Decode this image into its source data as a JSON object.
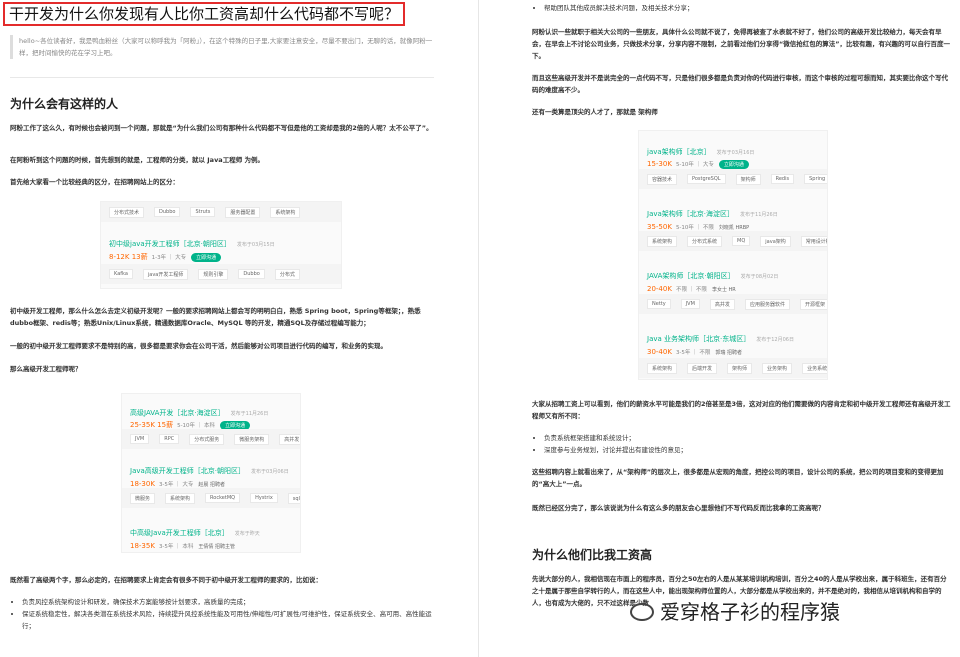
{
  "title": "干开发为什么你发现有人比你工资高却什么代码都不写呢？",
  "quote": "hello~各位读者好，我是鸭血粉丝（大家可以称呼我为「阿粉」），在这个特殊的日子里,大家要注意安全，尽量不要出门，无聊的话，就像阿粉一样，把时间愉快的花在学习上吧。",
  "sec1": {
    "heading": "为什么会有这样的人",
    "p1": "阿粉工作了这么久，有时候也会被问到一个问题，那就是“为什么我们公司有那种什么代码都不写但是他的工资却是我的2倍的人呢？太不公平了”。",
    "p2": "在阿粉听到这个问题的时候，首先想到的就是，工程师的分类，就以 Java工程师 为例。",
    "p3": "首先给大家看一个比较经典的区分，在招聘网站上的区分："
  },
  "card1": {
    "tags_top": [
      "分布式技术",
      "Dubbo",
      "Struts",
      "服务器配置",
      "系统架构"
    ],
    "title": "初中级java开发工程师［北京·朝阳区］",
    "pub": "发布于03月15日",
    "salary": "8-12K 13薪",
    "meta": "1-3年 ｜ 大专",
    "pill": "立即沟通",
    "tags_bottom": [
      "Kafka",
      "java开发工程师",
      "规则引擎",
      "Dubbo",
      "分布式"
    ]
  },
  "p_mid1": "初中级开发工程师，那么什么怎么去定义初级开发呢？一般的要求招聘网站上都会写的明明白白，熟悉 Spring boot，Spring等框架；，熟悉dubbo框架、redis等；熟悉Unix/Linux系统，精通数据库Oracle、MySQL 等的开发，精通SQL及存储过程编写能力；",
  "p_mid2": "一般的初中级开发工程师要求不是特别的高，很多都是要求你会在公司干活，然后能够对公司项目进行代码的编写，和业务的实现。",
  "p_mid3": "那么高级开发工程师呢？",
  "card2": {
    "jobs": [
      {
        "title": "高级JAVA开发［北京·海淀区］",
        "pub": "发布于11月26日",
        "salary": "25-35K 15薪",
        "meta": "5-10年 ｜ 本科",
        "pill": "立即沟通",
        "who": ""
      },
      {
        "title": "Java高级开发工程师［北京·朝阳区］",
        "pub": "发布于03月06日",
        "salary": "18-30K",
        "meta": "3-5年 ｜ 大专",
        "pill": "",
        "who": "赵晨 招聘者"
      },
      {
        "title": "中高级Java开发工程师［北京］",
        "pub": "发布于昨天",
        "salary": "18-35K",
        "meta": "3-5年 ｜ 本科",
        "pill": "",
        "who": "王倩倩 招聘主管"
      }
    ],
    "tags1": [
      "JVM",
      "RPC",
      "分布式服务",
      "微服务架构",
      "高并发"
    ],
    "tags2": [
      "微服务",
      "系统架构",
      "RocketMQ",
      "Hystrix",
      "sql优化"
    ]
  },
  "p_left_end": "既然看了高级两个字，那么必定的，在招聘要求上肯定会有很多不同于初中级开发工程师的要求的，比如说：",
  "left_bullets": [
    "负责风控系统架构设计和研发，确保技术方案能够按计划要求，高质量的完成；",
    "保证系统稳定性，解决各类潜在系统技术风险，持续提升风控系统性能及可用性/伸缩性/可扩展性/可维护性，保证系统安全、高可用、高性能运行；"
  ],
  "right_top_bullet": "帮助团队其他成员解决技术问题，及相关技术分享；",
  "r_p1": "阿粉认识一些就职于相关大公司的一些朋友，具体什么公司就不说了，免得再被查了水表就不好了，他们公司的高级开发比较给力，每天会有早会，在早会上不讨论公司业务，只做技术分享，分享内容不限制，之前看过他们分享得“微信抢红包的算法”，比较有趣，有兴趣的可以自行百度一下。",
  "r_p2": "而且这些高级开发并不是说完全的一点代码不写，只是他们很多都是负责对你的代码进行审核，而这个审核的过程可想而知，其实要比你这个写代码的难度高不少。",
  "r_p3": "还有一类算是顶尖的人才了，那就是 架构师",
  "card3": {
    "jobs": [
      {
        "title": "java架构师［北京］",
        "pub": "发布于03月16日",
        "salary": "15-30K",
        "meta": "5-10年 ｜ 大专",
        "pill": "立即沟通",
        "who": "",
        "tags": [
          "容器技术",
          "PostgreSQL",
          "架构师",
          "Redis",
          "Spring"
        ]
      },
      {
        "title": "Java架构师［北京·海淀区］",
        "pub": "发布于11月26日",
        "salary": "35-50K",
        "meta": "5-10年 ｜ 不限",
        "pill": "",
        "who": "刘晓凯 HRBP",
        "tags": [
          "系统架构",
          "分布式系统",
          "MQ",
          "java架构",
          "常用设计模式"
        ]
      },
      {
        "title": "JAVA架构师［北京·朝阳区］",
        "pub": "发布于08月02日",
        "salary": "20-40K",
        "meta": "不限 ｜ 不限",
        "pill": "",
        "who": "李女士 HR",
        "tags": [
          "Netty",
          "JVM",
          "高并发",
          "应用服务器软件",
          "开源框架"
        ]
      },
      {
        "title": "Java 业务架构师［北京·东城区］",
        "pub": "发布于12月06日",
        "salary": "30-40K",
        "meta": "3-5年 ｜ 不限",
        "pill": "",
        "who": "郭瑞 招聘者",
        "tags": [
          "系统架构",
          "后端开发",
          "架构师",
          "业务架构",
          "业务系统架构"
        ]
      }
    ]
  },
  "r_p4": "大家从招聘工资上可以看到，他们的薪资水平可能是我们的2倍甚至是3倍，这对对应的他们需要做的内容肯定和初中级开发工程师还有高级开发工程师又有所不同：",
  "right_bullets": [
    "负责系统框架搭建和系统设计；",
    "深度参与业务规划，讨论并提出有建设性的意见；"
  ],
  "r_p5": "这些招聘内容上就看出来了，从“架构师”的层次上，很多都是从宏观的角度，把控公司的项目，设计公司的系统，把公司的项目变和的变得更加的“高大上”一点。",
  "r_p6": "既然已经区分完了，那么该说说为什么有这么多的朋友会心里想他们不写代码反而比我拿的工资高呢？",
  "sec2_heading": "为什么他们比我工资高",
  "r_p7": "先说大部分的人，我相信现在市面上的程序员，百分之50左右的人是从某某培训机构培训，百分之40的人是从学校出来，属于科班生，还有百分之十是属于那些自学转行的人，而在这些人中，能出现架构师位置的人，大部分都是从学校出来的，并不是绝对的，我相信从培训机构和自学的人，也有成为大佬的，只不过这样是少数",
  "watermark": "爱穿格子衫的程序猿"
}
